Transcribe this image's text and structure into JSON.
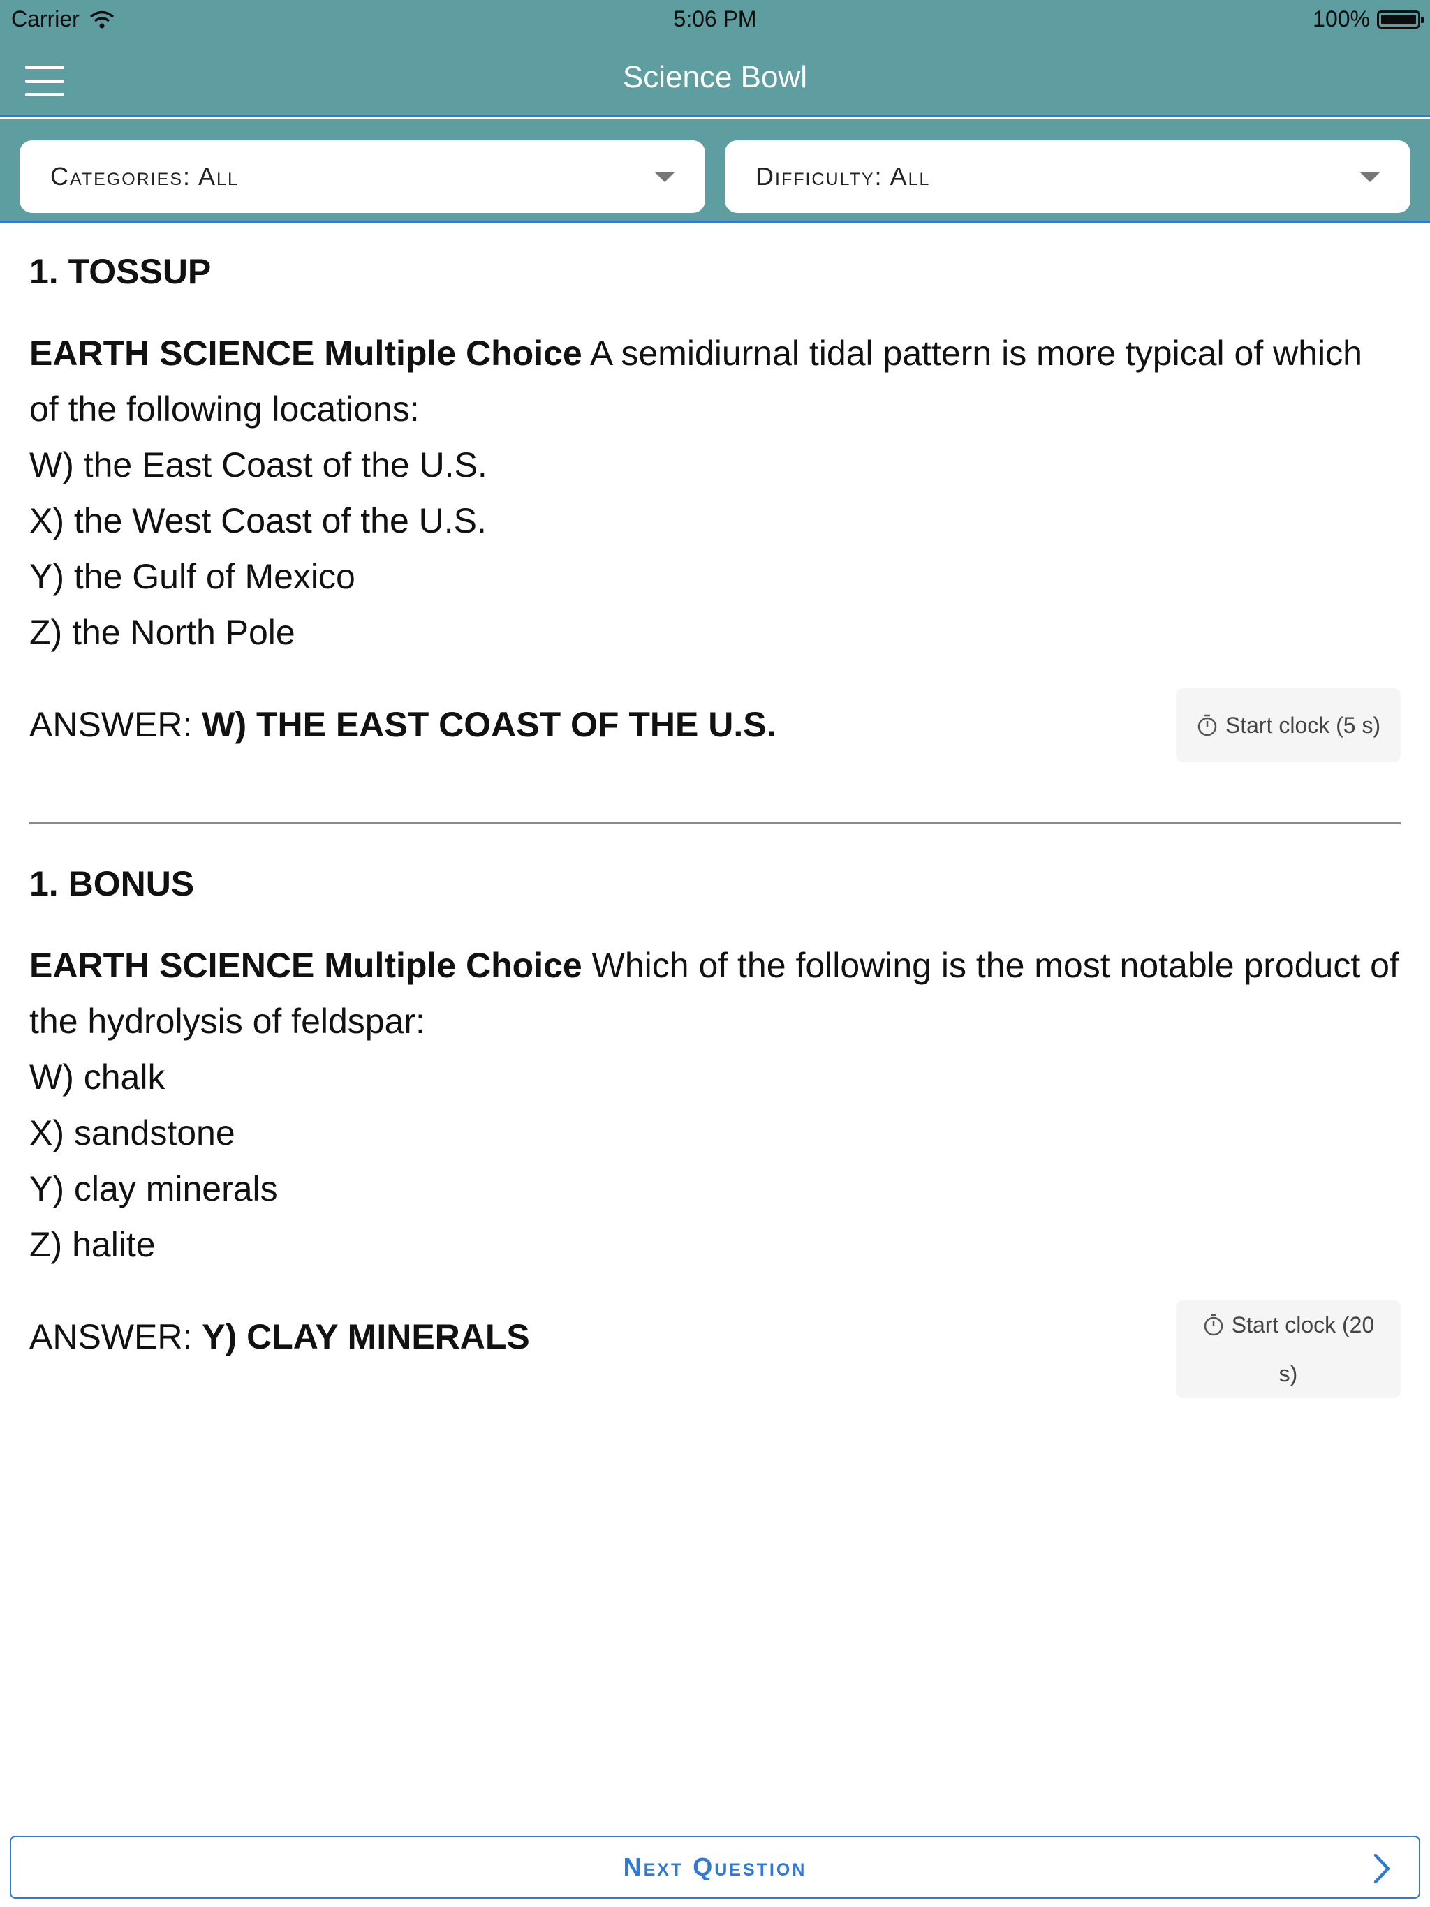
{
  "status_bar": {
    "carrier": "Carrier",
    "time": "5:06 PM",
    "battery": "100%"
  },
  "nav": {
    "title": "Science Bowl",
    "menu_icon": "hamburger-menu-icon"
  },
  "filters": {
    "categories": "Categories: All",
    "difficulty": "Difficulty: All"
  },
  "tossup": {
    "heading": "1. TOSSUP",
    "category": "EARTH SCIENCE Multiple Choice",
    "question": "A semidiurnal tidal pattern is more typical of which of the following locations:",
    "choices": [
      "W) the East Coast of the U.S.",
      "X) the West Coast of the U.S.",
      "Y) the Gulf of Mexico",
      "Z) the North Pole"
    ],
    "answer_label": "ANSWER:",
    "answer_value": "W) THE EAST COAST OF THE U.S.",
    "clock_label": "Start clock (5 s)"
  },
  "bonus": {
    "heading": "1. BONUS",
    "category": "EARTH SCIENCE Multiple Choice",
    "question": "Which of the following is the most notable product of the hydrolysis of feldspar:",
    "choices": [
      "W) chalk",
      "X) sandstone",
      "Y) clay minerals",
      "Z) halite"
    ],
    "answer_label": "ANSWER:",
    "answer_value": "Y) CLAY MINERALS",
    "clock_label_line1": "Start clock (20",
    "clock_label_line2": "s)"
  },
  "footer": {
    "next_label": "Next Question"
  },
  "colors": {
    "header": "#5f9ea0",
    "accent": "#2e7ad6"
  }
}
